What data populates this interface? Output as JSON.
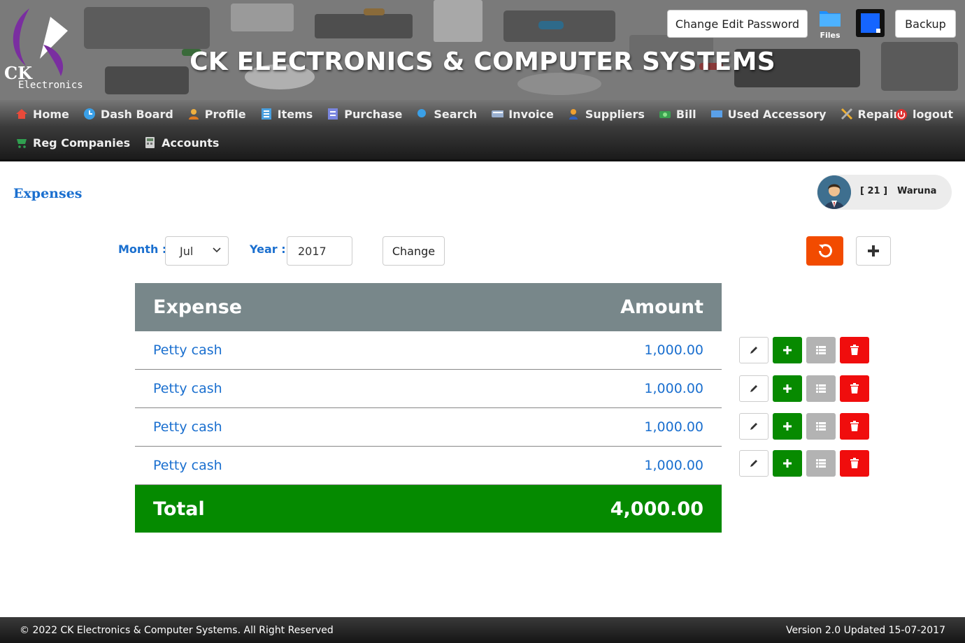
{
  "header": {
    "logo_text": "CK",
    "logo_subtext": "Electronics",
    "site_title": "CK ELECTRONICS & COMPUTER SYSTEMS",
    "change_password_label": "Change Edit Password",
    "files_label": "Files",
    "backup_label": "Backup"
  },
  "nav": {
    "row1": [
      {
        "label": "Home",
        "icon": "home-icon"
      },
      {
        "label": "Dash Board",
        "icon": "clock-icon"
      },
      {
        "label": "Profile",
        "icon": "user-icon"
      },
      {
        "label": "Items",
        "icon": "list-icon"
      },
      {
        "label": "Purchase",
        "icon": "receipt-icon"
      },
      {
        "label": "Search",
        "icon": "search-icon"
      },
      {
        "label": "Invoice",
        "icon": "keyboard-icon"
      },
      {
        "label": "Suppliers",
        "icon": "worker-icon"
      },
      {
        "label": "Bill",
        "icon": "money-icon"
      },
      {
        "label": "Used Accessory",
        "icon": "monitor-icon"
      },
      {
        "label": "Repairs",
        "icon": "tools-icon"
      }
    ],
    "logout_label": "logout",
    "row2": [
      {
        "label": "Reg Companies",
        "icon": "cart-icon"
      },
      {
        "label": "Accounts",
        "icon": "calculator-icon"
      }
    ]
  },
  "page": {
    "title": "Expenses",
    "user_id": "[ 21 ]",
    "user_name": "Waruna"
  },
  "filters": {
    "month_label": "Month :",
    "month_value": "Jul",
    "year_label": "Year :",
    "year_value": "2017",
    "change_label": "Change"
  },
  "table": {
    "col_expense": "Expense",
    "col_amount": "Amount",
    "rows": [
      {
        "expense": "Petty cash",
        "amount": "1,000.00"
      },
      {
        "expense": "Petty cash",
        "amount": "1,000.00"
      },
      {
        "expense": "Petty cash",
        "amount": "1,000.00"
      },
      {
        "expense": "Petty cash",
        "amount": "1,000.00"
      }
    ],
    "total_label": "Total",
    "total_value": "4,000.00"
  },
  "footer": {
    "copyright": "© 2022  CK Electronics & Computer Systems. All Right Reserved",
    "version": "Version 2.0 Updated 15-07-2017"
  },
  "colors": {
    "accent_blue": "#1a6fcf",
    "total_green": "#058a00",
    "delete_red": "#f00d0d",
    "refresh_orange": "#f24b00"
  }
}
